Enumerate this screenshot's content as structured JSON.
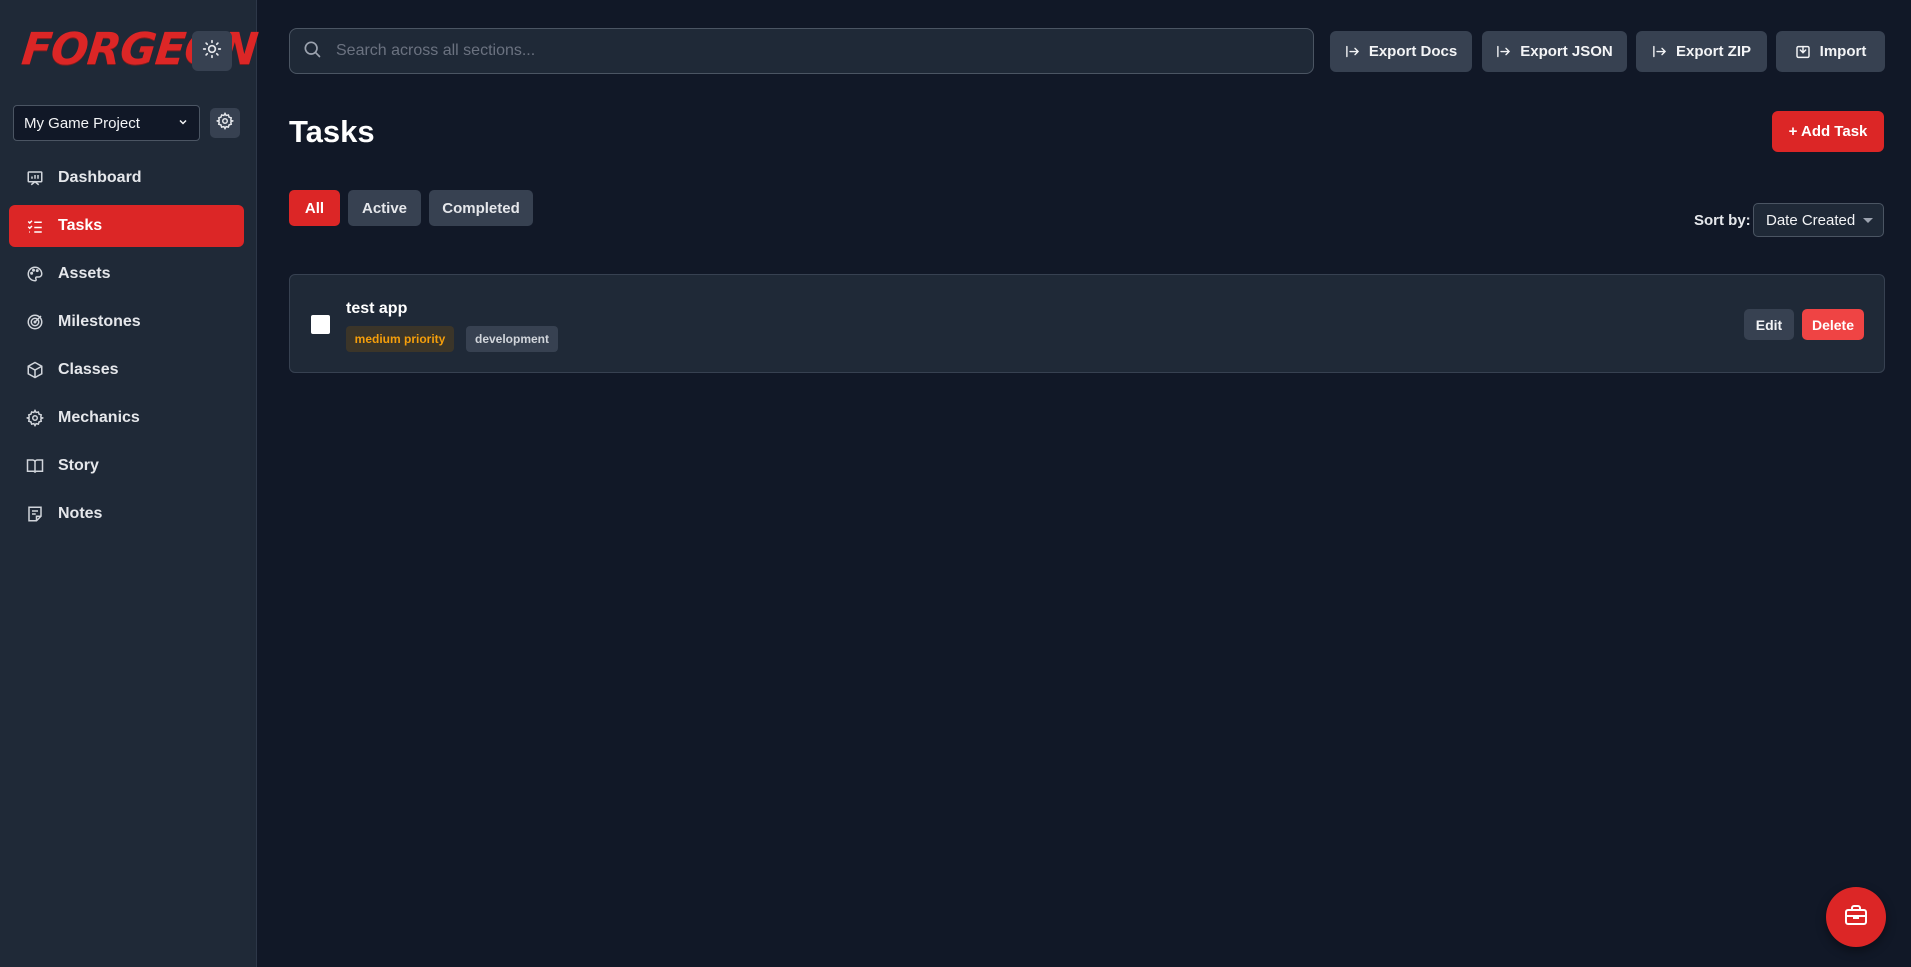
{
  "app": {
    "logo": "FORGEON"
  },
  "sidebar": {
    "project": "My Game Project",
    "items": [
      {
        "label": "Dashboard",
        "icon": "dashboard-icon"
      },
      {
        "label": "Tasks",
        "icon": "list-checks-icon",
        "active": true
      },
      {
        "label": "Assets",
        "icon": "palette-icon"
      },
      {
        "label": "Milestones",
        "icon": "target-icon"
      },
      {
        "label": "Classes",
        "icon": "cube-icon"
      },
      {
        "label": "Mechanics",
        "icon": "gear-icon"
      },
      {
        "label": "Story",
        "icon": "book-icon"
      },
      {
        "label": "Notes",
        "icon": "note-icon"
      }
    ]
  },
  "search": {
    "placeholder": "Search across all sections..."
  },
  "toolbar": {
    "export_docs": "Export Docs",
    "export_json": "Export JSON",
    "export_zip": "Export ZIP",
    "import": "Import"
  },
  "main": {
    "title": "Tasks",
    "add_task": "+ Add Task",
    "filters": [
      "All",
      "Active",
      "Completed"
    ],
    "active_filter": "All",
    "sort_label": "Sort by:",
    "sort_value": "Date Created"
  },
  "tasks": [
    {
      "title": "test app",
      "priority": "medium priority",
      "category": "development",
      "completed": false,
      "edit": "Edit",
      "delete": "Delete"
    }
  ],
  "colors": {
    "accent": "#dc2626",
    "background": "#111827",
    "sidebar": "#1f2937",
    "priority_medium": "#f59e0b"
  }
}
